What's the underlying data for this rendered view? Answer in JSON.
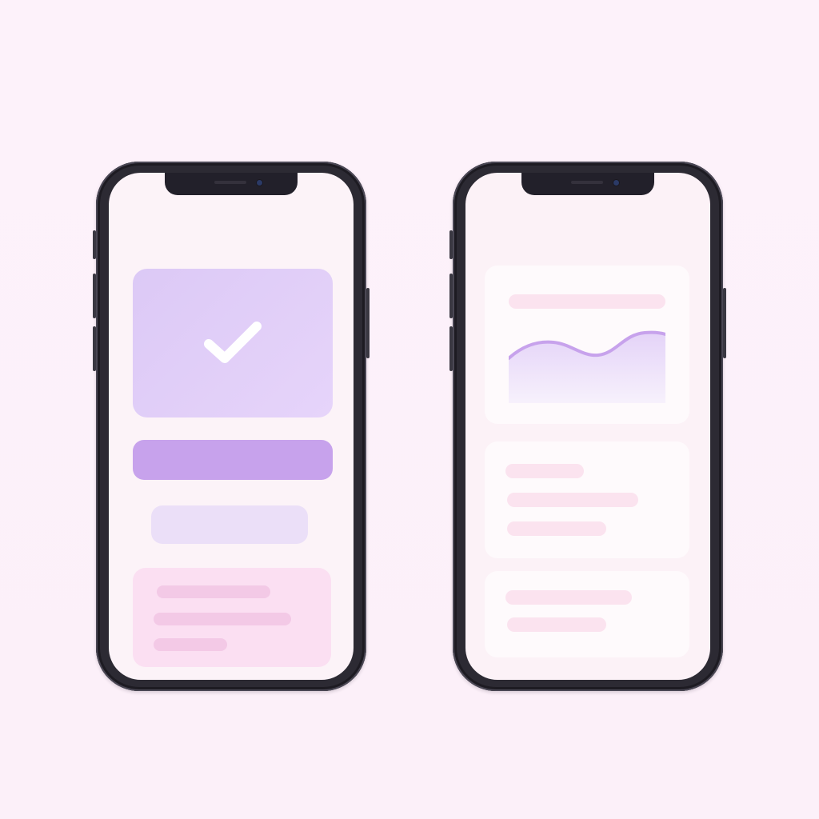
{
  "background": "#fcf0f9",
  "left_phone": {
    "hero_card": {
      "icon": "checkmark-icon",
      "color": "#dcc9f6"
    },
    "primary_bar_color": "#c7a2ec",
    "secondary_bar_color": "#ebdff8",
    "note_card_color": "#fbdff2"
  },
  "right_phone": {
    "chart_card": {
      "accent": "#c7a2ec",
      "fill": "#ece2fa"
    },
    "card_color": "#fefafc",
    "placeholder_line_color": "#fbe3ef"
  }
}
